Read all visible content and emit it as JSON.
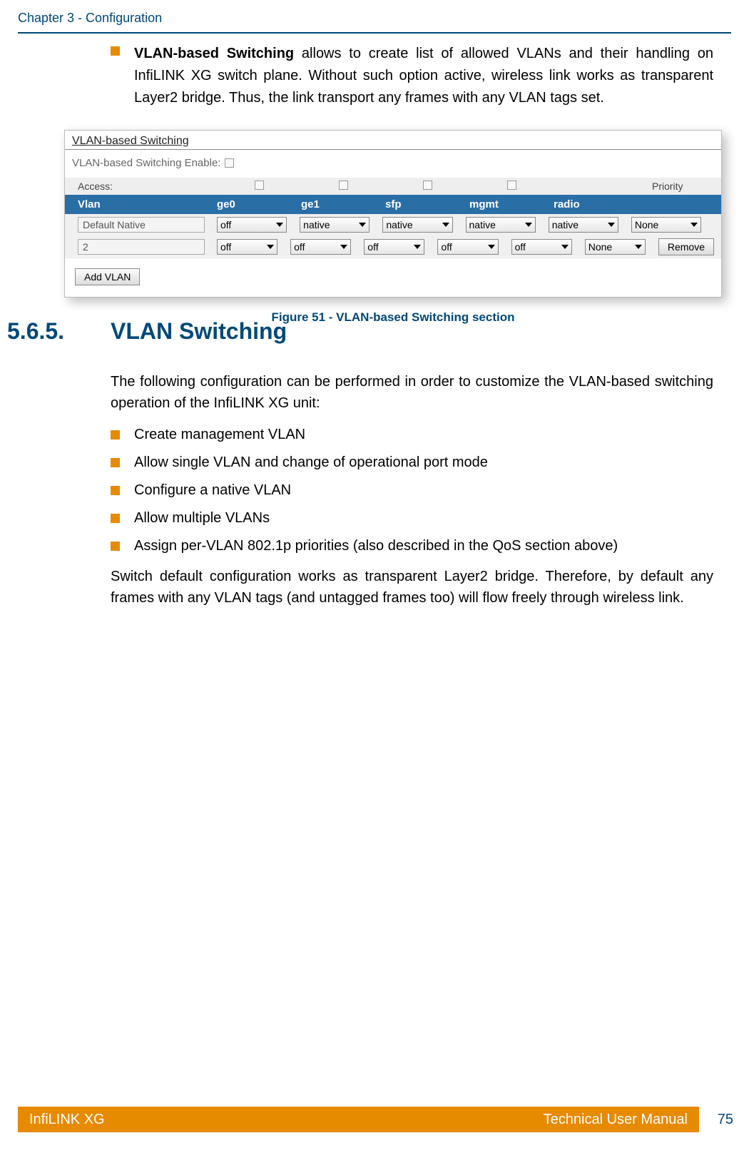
{
  "header": {
    "chapter": "Chapter 3 - Configuration"
  },
  "intro": {
    "bold": "VLAN-based Switching",
    "rest": " allows to create list of allowed VLANs and their handling on InfiLINK XG switch plane. Without such option active, wireless link works as transparent Layer2 bridge. Thus, the link transport any frames with any VLAN tags set."
  },
  "ui": {
    "title": "VLAN-based Switching",
    "enable_label": "VLAN-based Switching Enable:",
    "access_label": "Access:",
    "priority_label": "Priority",
    "headers": {
      "vlan": "Vlan",
      "ge0": "ge0",
      "ge1": "ge1",
      "sfp": "sfp",
      "mgmt": "mgmt",
      "radio": "radio"
    },
    "rows": [
      {
        "name": "Default Native",
        "ge0": "off",
        "ge1": "native",
        "sfp": "native",
        "mgmt": "native",
        "radio": "native",
        "priority": "None",
        "remove": ""
      },
      {
        "name": "2",
        "ge0": "off",
        "ge1": "off",
        "sfp": "off",
        "mgmt": "off",
        "radio": "off",
        "priority": "None",
        "remove": "Remove"
      }
    ],
    "add_vlan": "Add VLAN"
  },
  "figure_caption": "Figure 51 - VLAN-based Switching section",
  "section": {
    "number": "5.6.5.",
    "title": "VLAN Switching"
  },
  "para1": "The following configuration can be performed in order to customize the VLAN-based switching operation of the InfiLINK XG unit:",
  "list": {
    "item1": "Create management VLAN",
    "item2": "Allow single VLAN and change of operational port mode",
    "item3": "Configure a native VLAN",
    "item4": "Allow multiple VLANs",
    "item5": "Assign per-VLAN 802.1p priorities (also described in the QoS section above)"
  },
  "para2": "Switch default configuration works as transparent Layer2 bridge. Therefore, by default any frames with any VLAN tags (and untagged frames too) will flow freely through wireless link.",
  "footer": {
    "left": "InfiLINK XG",
    "right": "Technical User Manual",
    "page": "75"
  }
}
